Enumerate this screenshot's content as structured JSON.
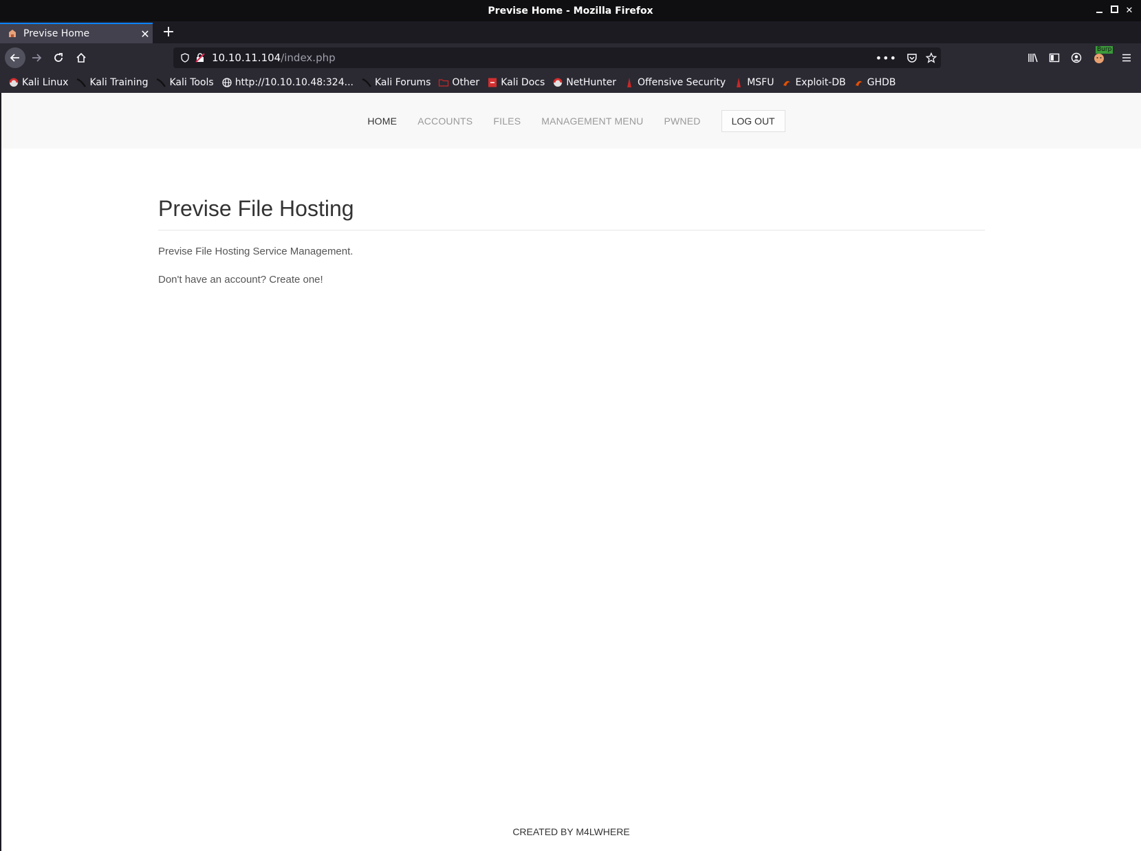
{
  "window": {
    "title": "Previse Home - Mozilla Firefox",
    "controls": {
      "close": "✕"
    }
  },
  "tabs": [
    {
      "title": "Previse Home",
      "close": "✕"
    }
  ],
  "new_tab": "+",
  "url": {
    "host": "10.10.11.104",
    "path": "/index.php"
  },
  "toolbar_icons": [
    "back-icon",
    "forward-icon",
    "reload-icon",
    "home-icon",
    "page-actions-icon",
    "pocket-icon",
    "bookmark-star-icon",
    "library-icon",
    "sidebar-icon",
    "account-icon",
    "burp-extension-icon",
    "menu-icon"
  ],
  "burp_badge": "Burp",
  "bookmarks": [
    {
      "label": "Kali Linux",
      "icon": "kali-icon"
    },
    {
      "label": "Kali Training",
      "icon": "kali-dragon-icon"
    },
    {
      "label": "Kali Tools",
      "icon": "kali-dragon-icon"
    },
    {
      "label": "http://10.10.10.48:324...",
      "icon": "globe-icon"
    },
    {
      "label": "Kali Forums",
      "icon": "kali-dragon-icon"
    },
    {
      "label": "Other",
      "icon": "folder-icon"
    },
    {
      "label": "Kali Docs",
      "icon": "kali-docs-icon"
    },
    {
      "label": "NetHunter",
      "icon": "kali-icon"
    },
    {
      "label": "Offensive Security",
      "icon": "offsec-icon"
    },
    {
      "label": "MSFU",
      "icon": "offsec-icon"
    },
    {
      "label": "Exploit-DB",
      "icon": "exploitdb-icon"
    },
    {
      "label": "GHDB",
      "icon": "exploitdb-icon"
    }
  ],
  "site": {
    "nav": [
      {
        "label": "HOME",
        "active": true
      },
      {
        "label": "ACCOUNTS",
        "active": false
      },
      {
        "label": "FILES",
        "active": false
      },
      {
        "label": "MANAGEMENT MENU",
        "active": false
      },
      {
        "label": "PWNED",
        "active": false
      }
    ],
    "logout": "LOG OUT",
    "heading": "Previse File Hosting",
    "description": "Previse File Hosting Service Management.",
    "account_prompt": "Don't have an account? Create one!",
    "footer": "CREATED BY M4LWHERE"
  },
  "colors": {
    "accent": "#0a84ff",
    "navbar_bg": "#f8f8f8",
    "text": "#333333",
    "muted": "#999999"
  }
}
